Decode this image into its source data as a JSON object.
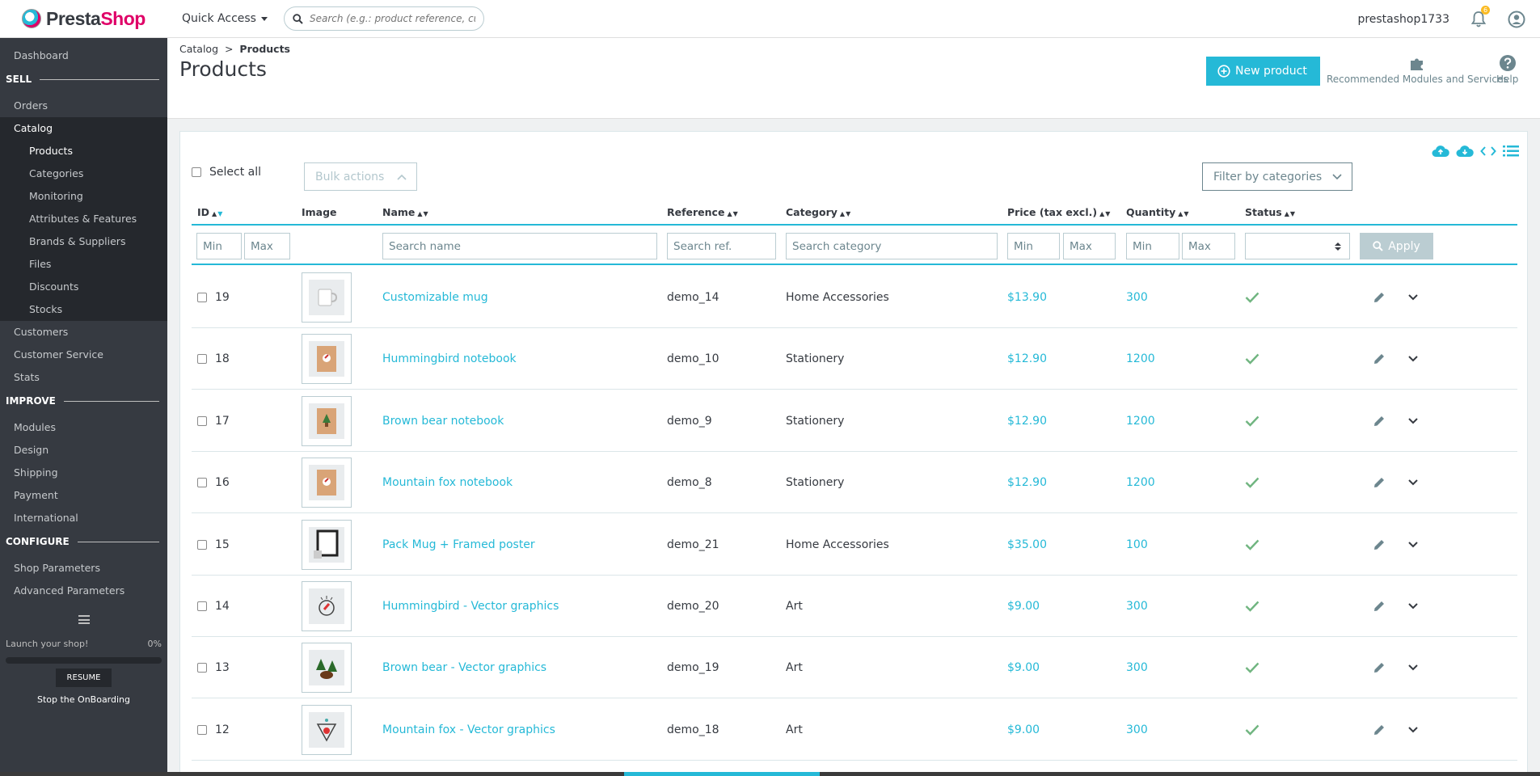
{
  "header": {
    "logo_prefix": "Presta",
    "logo_suffix": "Shop",
    "quick_access": "Quick Access",
    "search_placeholder": "Search (e.g.: product reference, customer name…)",
    "shop_name": "prestashop1733",
    "notifications_count": "6"
  },
  "sidebar": {
    "dashboard": "Dashboard",
    "sell": "SELL",
    "orders": "Orders",
    "catalog": "Catalog",
    "catalog_items": [
      "Products",
      "Categories",
      "Monitoring",
      "Attributes & Features",
      "Brands & Suppliers",
      "Files",
      "Discounts",
      "Stocks"
    ],
    "customers": "Customers",
    "customer_service": "Customer Service",
    "stats": "Stats",
    "improve": "IMPROVE",
    "improve_items": [
      "Modules",
      "Design",
      "Shipping",
      "Payment",
      "International"
    ],
    "configure": "CONFIGURE",
    "configure_items": [
      "Shop Parameters",
      "Advanced Parameters"
    ],
    "launch_label": "Launch your shop!",
    "launch_percent": "0%",
    "launch_progress": 0,
    "resume": "RESUME",
    "stop": "Stop the OnBoarding"
  },
  "page": {
    "breadcrumb_parent": "Catalog",
    "breadcrumb_sep": ">",
    "breadcrumb_current": "Products",
    "title": "Products",
    "new_product": "New product",
    "recommended": "Recommended Modules and Services",
    "help": "Help"
  },
  "toolbar": {
    "select_all": "Select all",
    "bulk_actions": "Bulk actions",
    "filter_by_categories": "Filter by categories"
  },
  "columns": {
    "id": "ID",
    "image": "Image",
    "name": "Name",
    "reference": "Reference",
    "category": "Category",
    "price": "Price (tax excl.)",
    "quantity": "Quantity",
    "status": "Status"
  },
  "filters": {
    "min": "Min",
    "max": "Max",
    "search_name": "Search name",
    "search_ref": "Search ref.",
    "search_category": "Search category",
    "apply": "Apply"
  },
  "products": [
    {
      "id": "19",
      "name": "Customizable mug",
      "reference": "demo_14",
      "category": "Home Accessories",
      "price": "$13.90",
      "quantity": "300",
      "thumb": "mug"
    },
    {
      "id": "18",
      "name": "Hummingbird notebook",
      "reference": "demo_10",
      "category": "Stationery",
      "price": "$12.90",
      "quantity": "1200",
      "thumb": "notebook"
    },
    {
      "id": "17",
      "name": "Brown bear notebook",
      "reference": "demo_9",
      "category": "Stationery",
      "price": "$12.90",
      "quantity": "1200",
      "thumb": "notebook-green"
    },
    {
      "id": "16",
      "name": "Mountain fox notebook",
      "reference": "demo_8",
      "category": "Stationery",
      "price": "$12.90",
      "quantity": "1200",
      "thumb": "notebook"
    },
    {
      "id": "15",
      "name": "Pack Mug + Framed poster",
      "reference": "demo_21",
      "category": "Home Accessories",
      "price": "$35.00",
      "quantity": "100",
      "thumb": "frame"
    },
    {
      "id": "14",
      "name": "Hummingbird - Vector graphics",
      "reference": "demo_20",
      "category": "Art",
      "price": "$9.00",
      "quantity": "300",
      "thumb": "vector-bird"
    },
    {
      "id": "13",
      "name": "Brown bear - Vector graphics",
      "reference": "demo_19",
      "category": "Art",
      "price": "$9.00",
      "quantity": "300",
      "thumb": "vector-bear"
    },
    {
      "id": "12",
      "name": "Mountain fox - Vector graphics",
      "reference": "demo_18",
      "category": "Art",
      "price": "$9.00",
      "quantity": "300",
      "thumb": "vector-fox"
    }
  ],
  "colors": {
    "accent": "#25b9d7",
    "sidebar": "#363a41",
    "status_ok": "#70b580",
    "brand_pink": "#df0067"
  },
  "icons": {
    "status": "check-icon",
    "edit": "pencil-icon",
    "more": "chevron-down-icon"
  }
}
